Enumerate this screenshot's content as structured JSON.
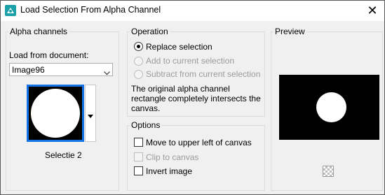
{
  "window": {
    "title": "Load Selection From Alpha Channel",
    "close_glyph": "✕"
  },
  "alpha_channels": {
    "group_label": "Alpha channels",
    "load_from_label": "Load from document:",
    "document_value": "Image96",
    "channel_name": "Selectie 2"
  },
  "operation": {
    "group_label": "Operation",
    "options": [
      {
        "label": "Replace selection",
        "selected": true,
        "enabled": true
      },
      {
        "label": "Add to current selection",
        "selected": false,
        "enabled": false
      },
      {
        "label": "Subtract from current selection",
        "selected": false,
        "enabled": false
      }
    ],
    "note_line1": "The original alpha channel",
    "note_line2": "rectangle completely intersects the",
    "note_line3": "canvas."
  },
  "options": {
    "group_label": "Options",
    "items": [
      {
        "label": "Move to upper left of canvas",
        "checked": false,
        "enabled": true
      },
      {
        "label": "Clip to canvas",
        "checked": false,
        "enabled": false
      },
      {
        "label": "Invert image",
        "checked": false,
        "enabled": true
      }
    ]
  },
  "preview": {
    "group_label": "Preview"
  },
  "icons": {
    "app": "app-icon",
    "dropdown": "chevron-down-icon",
    "checker": "checkerboard-icon"
  }
}
